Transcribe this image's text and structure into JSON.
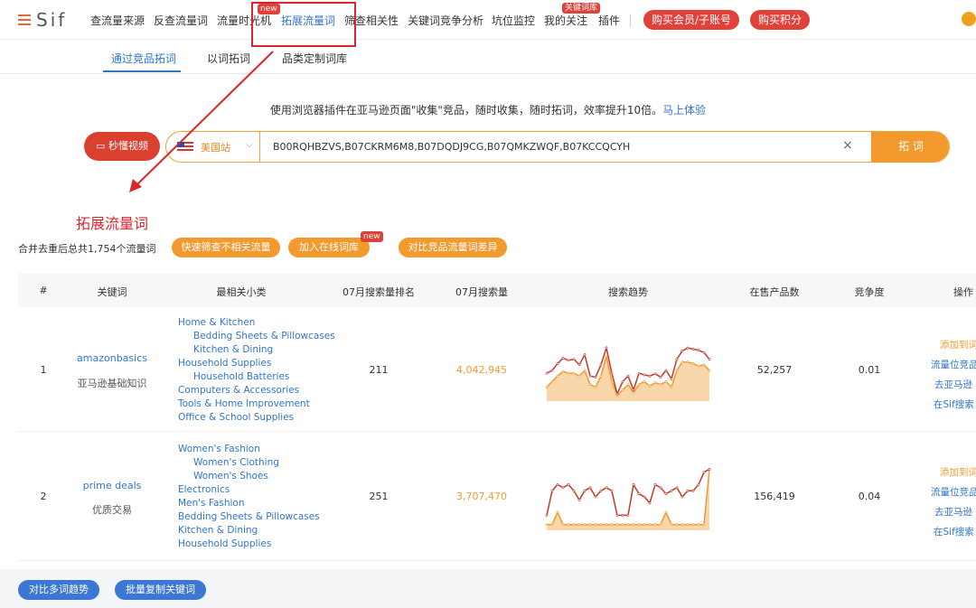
{
  "brand": {
    "name": "Sif"
  },
  "nav": {
    "items": [
      "查流量来源",
      "反查流量词",
      "流量时光机",
      "拓展流量词",
      "筛查相关性",
      "关键词竞争分析",
      "坑位监控",
      "我的关注",
      "插件"
    ],
    "active": "拓展流量词",
    "new_badge": "new",
    "keyword_lib_badge": "关键词库",
    "buy_member": "购买会员/子账号",
    "buy_points": "购买积分"
  },
  "tabs": [
    "通过竞品拓词",
    "以词拓词",
    "品类定制词库"
  ],
  "hint": {
    "text": "使用浏览器插件在亚马逊页面\"收集\"竞品，随时收集，随时拓词，效率提升10倍。",
    "link": "马上体验"
  },
  "search": {
    "video_btn": "秒懂视频",
    "country": "美国站",
    "value": "B00RQHBZVS,B07CKRM6M8,B07DQDJ9CG,B07QMKZWQF,B07KCCQCYH",
    "submit": "拓 词",
    "clear_icon": "×"
  },
  "annotation": {
    "label": "拓展流量词",
    "color": "#d9262c"
  },
  "summary": "合并去重后总共1,754个流量词",
  "actions": {
    "filter": "快速筛查不相关流量",
    "add_lib": "加入在线词库",
    "add_lib_badge": "new",
    "compare": "对比竞品流量词差异"
  },
  "table": {
    "headers": [
      "#",
      "关键词",
      "最相关小类",
      "07月搜索量排名",
      "07月搜索量",
      "搜索趋势",
      "在售产品数",
      "竞争度",
      "操作"
    ],
    "rows": [
      {
        "index": "1",
        "keyword": "amazonbasics",
        "keyword_cn": "亚马逊基础知识",
        "categories": [
          {
            "name": "Home & Kitchen",
            "indent": false
          },
          {
            "name": "Bedding Sheets & Pillowcases",
            "indent": true
          },
          {
            "name": "Kitchen & Dining",
            "indent": true
          },
          {
            "name": "Household Supplies",
            "indent": false
          },
          {
            "name": "Household Batteries",
            "indent": true
          },
          {
            "name": "Computers & Accessories",
            "indent": false
          },
          {
            "name": "Tools & Home Improvement",
            "indent": false
          },
          {
            "name": "Office & School Supplies",
            "indent": false
          }
        ],
        "rank": "211",
        "volume": "4,042,945",
        "products": "52,257",
        "competition": "0.01",
        "ops": [
          "添加到词",
          "流量位竞品",
          "去亚马逊",
          "在Sif搜索"
        ]
      },
      {
        "index": "2",
        "keyword": "prime deals",
        "keyword_cn": "优质交易",
        "categories": [
          {
            "name": "Women's Fashion",
            "indent": false
          },
          {
            "name": "Women's Clothing",
            "indent": true
          },
          {
            "name": "Women's Shoes",
            "indent": true
          },
          {
            "name": "Electronics",
            "indent": false
          },
          {
            "name": "Men's Fashion",
            "indent": false
          },
          {
            "name": "Bedding Sheets & Pillowcases",
            "indent": false
          },
          {
            "name": "Kitchen & Dining",
            "indent": false
          },
          {
            "name": "Household Supplies",
            "indent": false
          }
        ],
        "rank": "251",
        "volume": "3,707,470",
        "products": "156,419",
        "competition": "0.04",
        "ops": [
          "添加到词",
          "流量位竞品",
          "去亚马逊",
          "在Sif搜索"
        ]
      }
    ]
  },
  "trend": {
    "colors": {
      "red": "#c0392b",
      "orange": "#f29a2e"
    },
    "rows": [
      {
        "red": [
          0.55,
          0.5,
          0.38,
          0.28,
          0.32,
          0.3,
          0.4,
          0.22,
          0.6,
          0.62,
          0.4,
          0.1,
          0.55,
          0.92,
          0.7,
          0.6,
          0.85,
          0.55,
          0.58,
          0.6,
          0.56,
          0.62,
          0.5,
          0.65,
          0.3,
          0.15,
          0.1,
          0.12,
          0.14,
          0.18,
          0.3
        ],
        "orange": [
          0.8,
          0.7,
          0.6,
          0.52,
          0.55,
          0.55,
          0.6,
          0.5,
          0.75,
          0.8,
          0.6,
          0.25,
          0.7,
          0.95,
          0.85,
          0.75,
          0.9,
          0.75,
          0.7,
          0.78,
          0.72,
          0.75,
          0.7,
          0.8,
          0.5,
          0.35,
          0.35,
          0.38,
          0.42,
          0.4,
          0.5
        ]
      },
      {
        "red": [
          0.8,
          0.4,
          0.3,
          0.35,
          0.3,
          0.4,
          0.55,
          0.4,
          0.35,
          0.5,
          0.4,
          0.35,
          0.4,
          0.8,
          0.8,
          0.8,
          0.3,
          0.45,
          0.5,
          0.6,
          0.3,
          0.35,
          0.45,
          0.4,
          0.35,
          0.5,
          0.4,
          0.4,
          0.3,
          0.1,
          0.05
        ],
        "orange": [
          0.95,
          0.95,
          0.75,
          0.95,
          0.95,
          0.95,
          0.95,
          0.95,
          0.95,
          0.95,
          0.95,
          0.95,
          0.95,
          0.95,
          0.95,
          0.95,
          0.95,
          0.95,
          0.95,
          0.95,
          0.95,
          0.95,
          0.75,
          0.95,
          0.95,
          0.95,
          0.95,
          0.95,
          0.95,
          0.95,
          0.05
        ]
      }
    ]
  },
  "footer": {
    "compare": "对比多词趋势",
    "copy": "批量复制关键词"
  }
}
